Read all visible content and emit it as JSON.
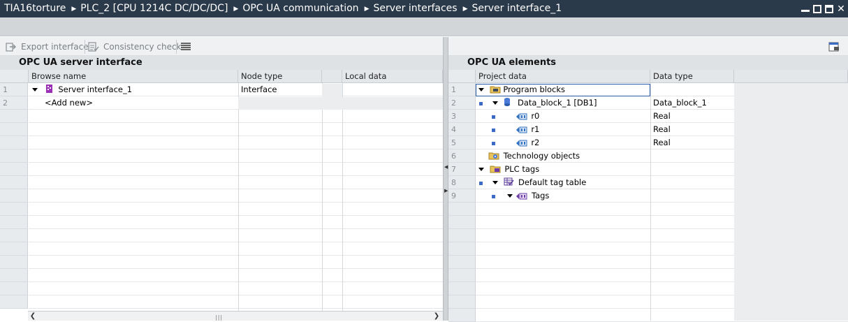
{
  "breadcrumb": {
    "items": [
      "TIA16torture",
      "PLC_2 [CPU 1214C DC/DC/DC]",
      "OPC UA communication",
      "Server interfaces",
      "Server interface_1"
    ]
  },
  "toolbar": {
    "export_label": "Export interface",
    "consistency_label": "Consistency check"
  },
  "left_pane": {
    "title": "OPC UA server interface",
    "columns": [
      "Browse name",
      "Node type",
      "Local data"
    ],
    "rows": [
      {
        "num": "1",
        "name": "Server interface_1",
        "type": "Interface"
      },
      {
        "num": "2",
        "name": "<Add new>",
        "type": ""
      }
    ]
  },
  "right_pane": {
    "title": "OPC UA elements",
    "columns": [
      "Project data",
      "Data type"
    ],
    "rows": [
      {
        "num": "1",
        "name": "Program blocks",
        "type": ""
      },
      {
        "num": "2",
        "name": "Data_block_1 [DB1]",
        "type": "Data_block_1"
      },
      {
        "num": "3",
        "name": "r0",
        "type": "Real"
      },
      {
        "num": "4",
        "name": "r1",
        "type": "Real"
      },
      {
        "num": "5",
        "name": "r2",
        "type": "Real"
      },
      {
        "num": "6",
        "name": "Technology objects",
        "type": ""
      },
      {
        "num": "7",
        "name": "PLC tags",
        "type": ""
      },
      {
        "num": "8",
        "name": "Default tag table",
        "type": ""
      },
      {
        "num": "9",
        "name": "Tags",
        "type": ""
      }
    ]
  },
  "colors": {
    "titlebar": "#2b3a4a",
    "bullet": "#3b6bc4",
    "interface_icon": "#9b2fb5"
  }
}
